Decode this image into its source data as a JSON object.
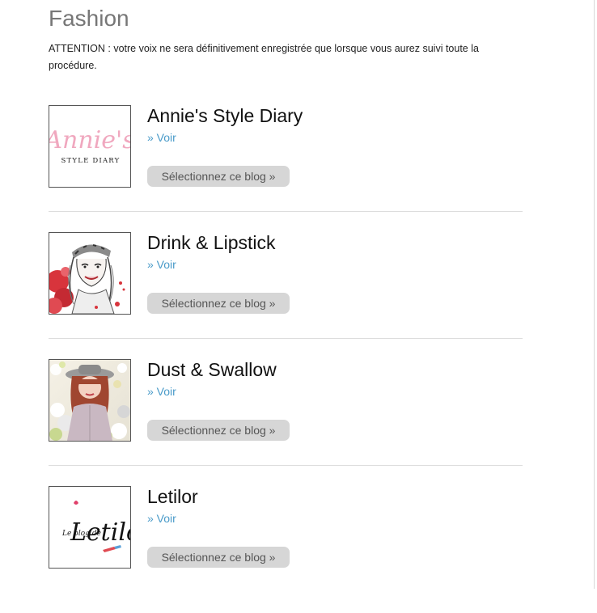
{
  "page": {
    "title": "Fashion",
    "notice": "ATTENTION : votre voix ne sera définitivement enregistrée que lorsque vous aurez suivi toute la procédure."
  },
  "blogs": [
    {
      "name": "Annie's Style Diary",
      "voir_label": "» Voir",
      "select_label": "Sélectionnez ce blog »",
      "logo_script": "Annie's",
      "logo_subtitle": "STYLE DIARY",
      "logo_color": "#f0a8bf"
    },
    {
      "name": "Drink & Lipstick",
      "voir_label": "» Voir",
      "select_label": "Sélectionnez ce blog »",
      "accent_color": "#d8343c"
    },
    {
      "name": "Dust & Swallow",
      "voir_label": "» Voir",
      "select_label": "Sélectionnez ce blog »"
    },
    {
      "name": "Letilor",
      "voir_label": "» Voir",
      "select_label": "Sélectionnez ce blog »",
      "logo_prefix": "Le blog de",
      "logo_name": "Letilor"
    }
  ]
}
